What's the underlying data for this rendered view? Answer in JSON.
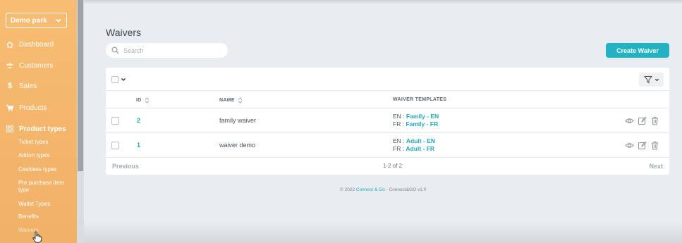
{
  "sidebar": {
    "park_select": "Demo park",
    "items": [
      {
        "label": "Dashboard",
        "icon": "home-icon"
      },
      {
        "label": "Customers",
        "icon": "users-icon"
      },
      {
        "label": "Sales",
        "icon": "dollar-icon"
      },
      {
        "label": "Products",
        "icon": "cart-icon"
      },
      {
        "label": "Product types",
        "icon": "grid-icon"
      }
    ],
    "sub_items": [
      "Ticket types",
      "Addon types",
      "Cashless types",
      "Pre purchase item type",
      "Wallet Types",
      "Benefits",
      "Waivers"
    ]
  },
  "main": {
    "title": "Waivers",
    "search_placeholder": "Search",
    "create_button": "Create Waiver",
    "table": {
      "columns": [
        "ID",
        "NAME",
        "WAIVER TEMPLATES"
      ],
      "rows": [
        {
          "id": "2",
          "name": "family waiver",
          "t1_lang": "EN : ",
          "t1": "Family - EN",
          "t2_lang": "FR : ",
          "t2": "Family - FR"
        },
        {
          "id": "1",
          "name": "waiver demo",
          "t1_lang": "EN : ",
          "t1": "Adult - EN",
          "t2_lang": "FR : ",
          "t2": "Adult - FR"
        }
      ],
      "prev": "Previous",
      "page_info": "1-2 of 2",
      "next": "Next"
    },
    "footer": {
      "prefix": "© 2022 ",
      "company": "Connect & Go",
      "suffix": " - Connect&GO v1.0"
    }
  },
  "colors": {
    "sidebar": "#f5b96e",
    "accent": "#23b2c1",
    "link": "#23a7b8"
  }
}
